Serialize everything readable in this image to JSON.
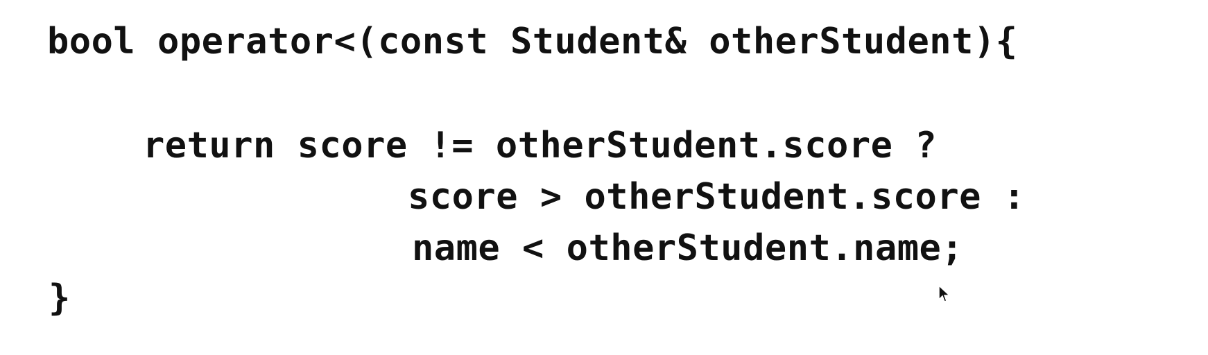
{
  "code": {
    "lines": [
      "bool operator<(const Student& otherStudent){",
      "return score != otherStudent.score ?",
      "score > otherStudent.score :",
      "name < otherStudent.name;",
      "}"
    ]
  },
  "cursor": {
    "icon": "mouse-pointer-icon"
  }
}
